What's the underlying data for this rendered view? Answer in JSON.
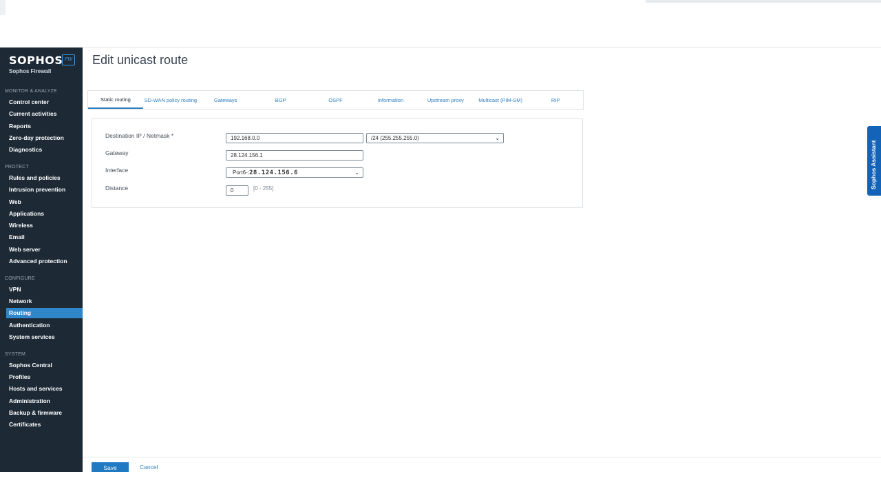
{
  "app": {
    "brand": "SOPHOS",
    "brand_badge": "FW",
    "brand_sub": "Sophos Firewall",
    "brand_color": "#1d2a36",
    "accent_color": "#2f86c8"
  },
  "sidebar": {
    "sections": [
      {
        "title": "MONITOR & ANALYZE",
        "items": [
          "Control center",
          "Current activities",
          "Reports",
          "Zero-day protection",
          "Diagnostics"
        ]
      },
      {
        "title": "PROTECT",
        "items": [
          "Rules and policies",
          "Intrusion prevention",
          "Web",
          "Applications",
          "Wireless",
          "Email",
          "Web server",
          "Advanced protection"
        ]
      },
      {
        "title": "CONFIGURE",
        "items": [
          "VPN",
          "Network",
          "Routing",
          "Authentication",
          "System services"
        ]
      },
      {
        "title": "SYSTEM",
        "items": [
          "Sophos Central",
          "Profiles",
          "Hosts and services",
          "Administration",
          "Backup & firmware",
          "Certificates"
        ]
      }
    ],
    "active_item": "Routing"
  },
  "page": {
    "title": "Edit unicast route"
  },
  "tabs": [
    {
      "label": "Static routing",
      "active": true
    },
    {
      "label": "SD-WAN policy routing",
      "active": false
    },
    {
      "label": "Gateways",
      "active": false
    },
    {
      "label": "BGP",
      "active": false
    },
    {
      "label": "OSPF",
      "active": false
    },
    {
      "label": "Information",
      "active": false
    },
    {
      "label": "Upstream proxy",
      "active": false
    },
    {
      "label": "Multicast (PIM-SM)",
      "active": false
    },
    {
      "label": "RIP",
      "active": false
    }
  ],
  "form": {
    "destination_label": "Destination IP / Netmask *",
    "destination_ip": "192.168.0.0",
    "netmask": "/24 (255.255.255.0)",
    "gateway_label": "Gateway",
    "gateway": "28.124.156.1",
    "interface_label": "Interface",
    "interface_prefix": "Port6-:",
    "interface_value": "28.124.156.6",
    "distance_label": "Distance",
    "distance": "0",
    "distance_hint": "[0 - 255]"
  },
  "assistant": {
    "label": "Sophos Assistant"
  },
  "footer": {
    "save_label": "Save",
    "cancel_label": "Cancel"
  }
}
